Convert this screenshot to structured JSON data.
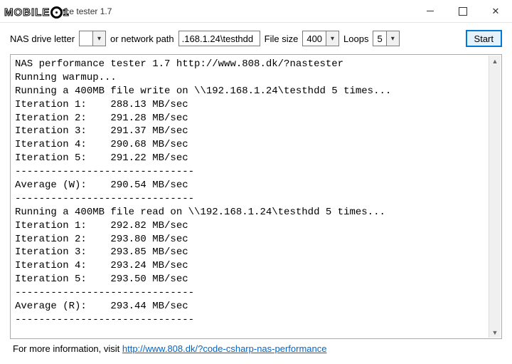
{
  "window": {
    "title_visible": "ance tester 1.7"
  },
  "toolbar": {
    "drive_label": "NAS drive letter",
    "drive_value": "",
    "path_label": "or network path",
    "path_value": ".168.1.24\\testhdd",
    "filesize_label": "File size",
    "filesize_value": "400",
    "loops_label": "Loops",
    "loops_value": "5",
    "start_label": "Start"
  },
  "log_text": "NAS performance tester 1.7 http://www.808.dk/?nastester\nRunning warmup...\nRunning a 400MB file write on \\\\192.168.1.24\\testhdd 5 times...\nIteration 1:    288.13 MB/sec\nIteration 2:    291.28 MB/sec\nIteration 3:    291.37 MB/sec\nIteration 4:    290.68 MB/sec\nIteration 5:    291.22 MB/sec\n------------------------------\nAverage (W):    290.54 MB/sec\n------------------------------\nRunning a 400MB file read on \\\\192.168.1.24\\testhdd 5 times...\nIteration 1:    292.82 MB/sec\nIteration 2:    293.80 MB/sec\nIteration 3:    293.85 MB/sec\nIteration 4:    293.24 MB/sec\nIteration 5:    293.50 MB/sec\n------------------------------\nAverage (R):    293.44 MB/sec\n------------------------------",
  "footer": {
    "prefix": "For more information, visit  ",
    "link_text": "http://www.808.dk/?code-csharp-nas-performance"
  },
  "watermark": "MOBILE"
}
